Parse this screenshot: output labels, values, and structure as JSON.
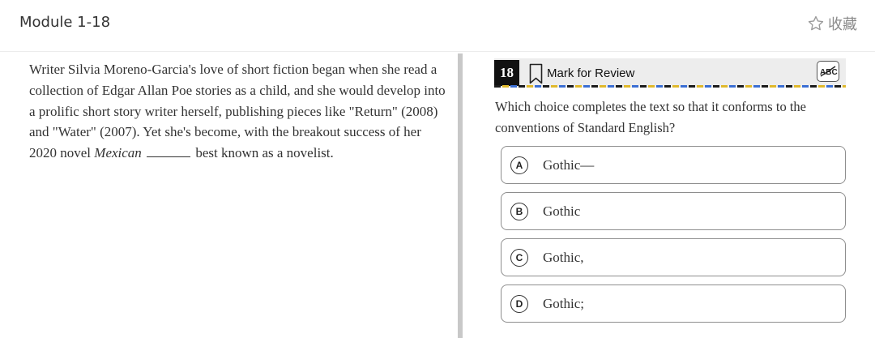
{
  "header": {
    "module_title": "Module 1-18",
    "favorite_label": "收藏"
  },
  "passage": {
    "text_before": "Writer Silvia Moreno-Garcia's love of short fiction began when she read a collection of Edgar Allan Poe stories as a child, and she would develop into a prolific short story writer herself, publishing pieces like \"Return\" (2008) and \"Water\" (2007). Yet she's become, with the breakout success of her 2020 novel ",
    "italic_title": "Mexican",
    "text_after": " best known as a novelist."
  },
  "question": {
    "number": "18",
    "mark_label": "Mark for Review",
    "prompt": "Which choice completes the text so that it conforms to the conventions of Standard English?",
    "choices": [
      {
        "letter": "A",
        "text": "Gothic—"
      },
      {
        "letter": "B",
        "text": "Gothic"
      },
      {
        "letter": "C",
        "text": "Gothic,"
      },
      {
        "letter": "D",
        "text": "Gothic;"
      }
    ]
  },
  "icons": {
    "favorite": "star-outline-icon",
    "bookmark": "bookmark-icon",
    "eliminator": "abc-strikethrough-icon"
  },
  "colors": {
    "question_number_bg": "#111111",
    "header_strip_bg": "#ededed",
    "divider": "#c8c8c8",
    "choice_border": "#8e8e8e"
  }
}
